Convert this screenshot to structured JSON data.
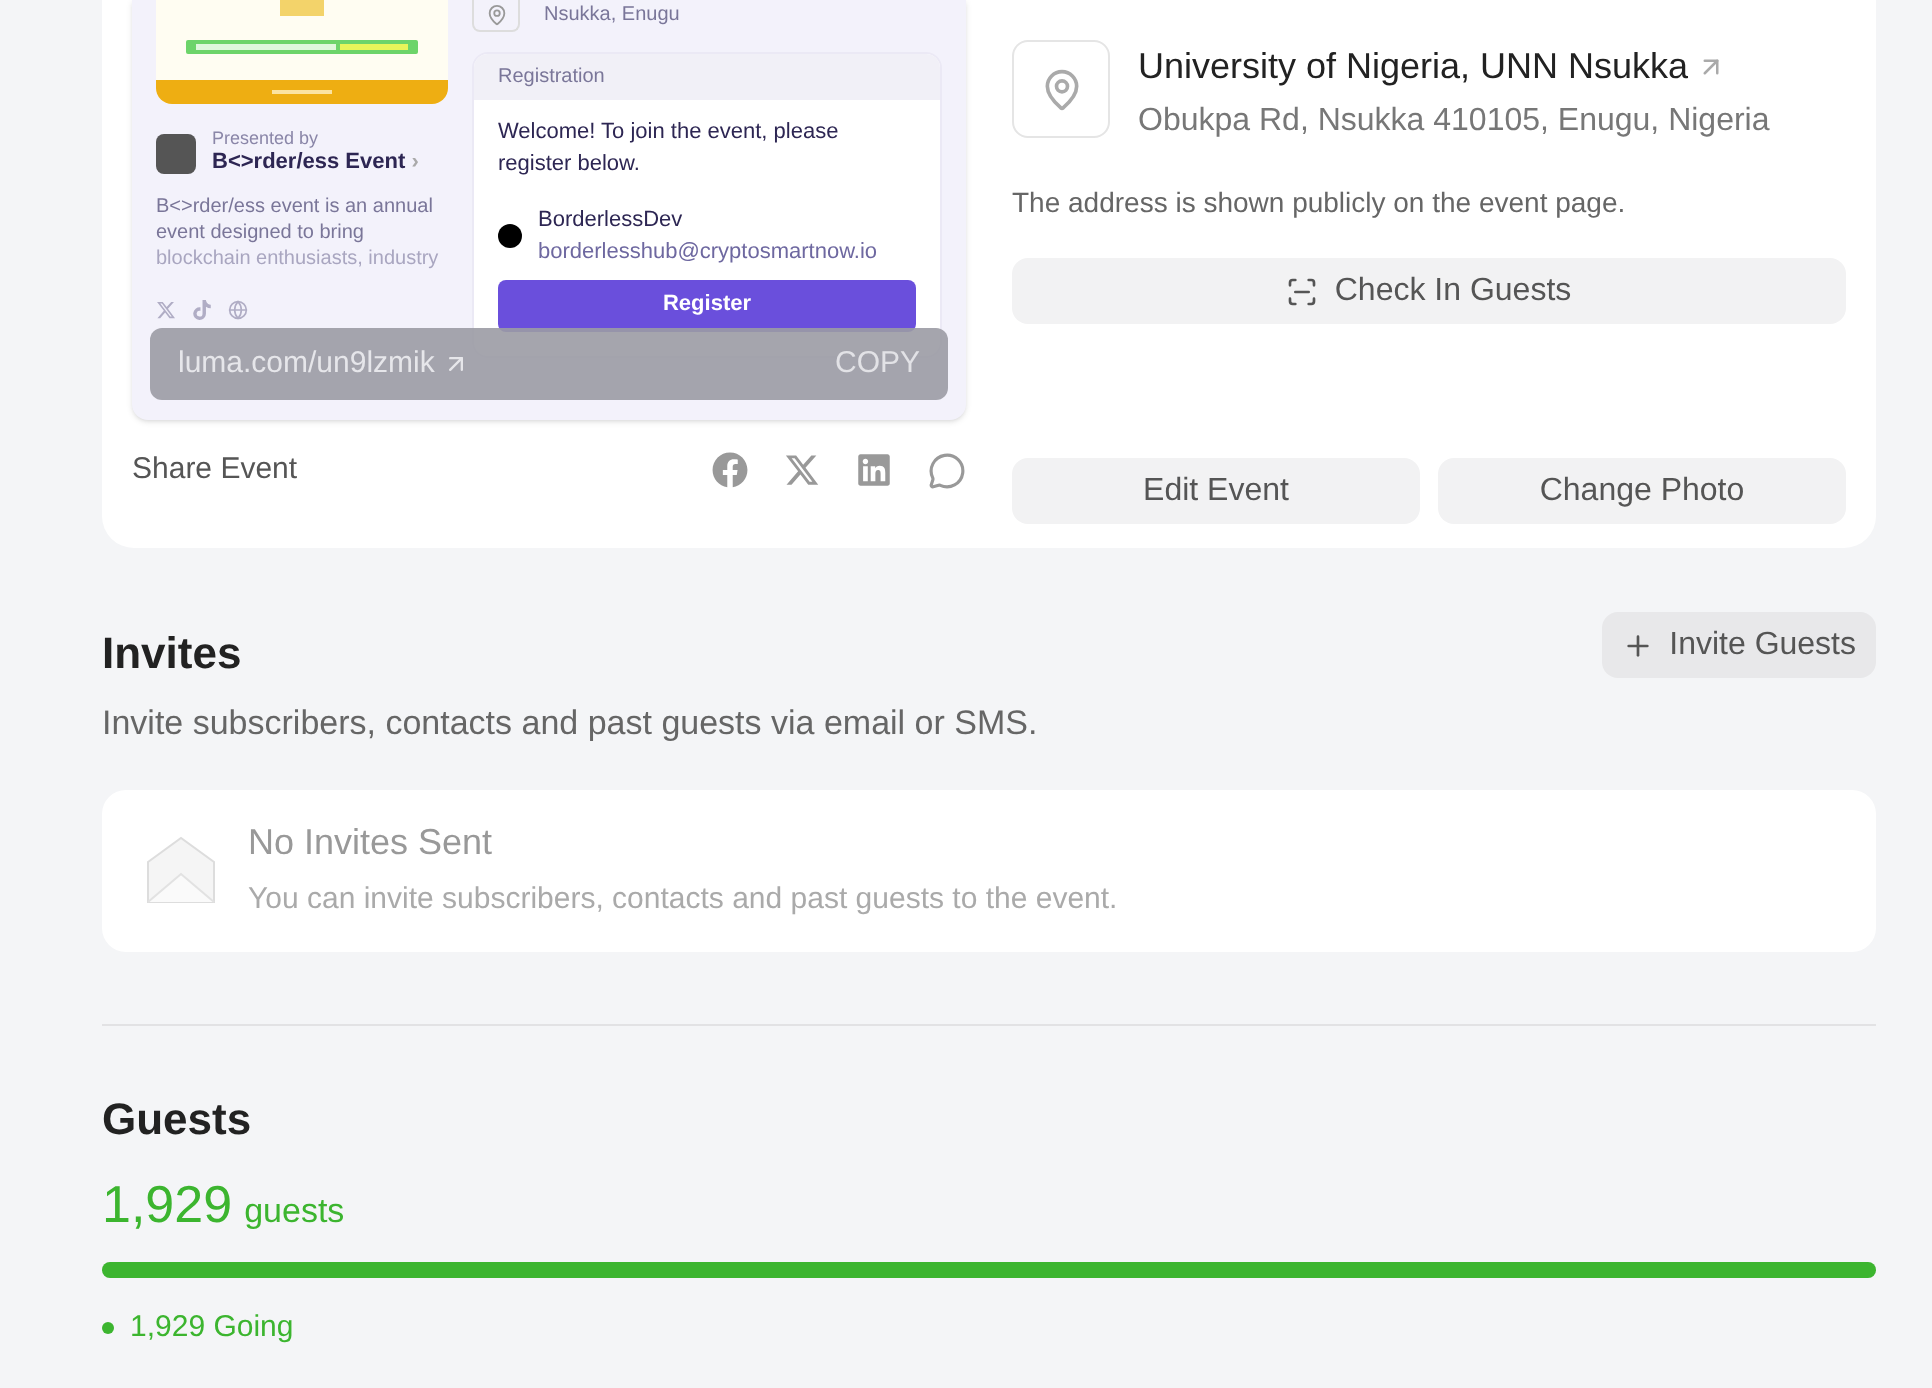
{
  "preview": {
    "presenter": {
      "caption": "Presented by",
      "name": "B<>rder/ess Event",
      "chevron": "›"
    },
    "description": "B<>rder/ess event is an annual event designed to bring",
    "description_faded": "blockchain enthusiasts, industry",
    "location": "Nsukka, Enugu",
    "registration": {
      "title": "Registration",
      "message": "Welcome! To join the event, please register below.",
      "host_name": "BorderlessDev",
      "host_email": "borderlesshub@cryptosmartnow.io",
      "button": "Register"
    },
    "link": {
      "url": "luma.com/un9lzmik",
      "copy": "COPY"
    }
  },
  "share": {
    "label": "Share Event"
  },
  "location": {
    "name": "University of Nigeria, UNN Nsukka",
    "address": "Obukpa Rd, Nsukka 410105, Enugu, Nigeria",
    "note": "The address is shown publicly on the event page."
  },
  "buttons": {
    "check_in": "Check In Guests",
    "edit": "Edit Event",
    "change_photo": "Change Photo"
  },
  "invites": {
    "title": "Invites",
    "subtitle": "Invite subscribers, contacts and past guests via email or SMS.",
    "button": "Invite Guests",
    "empty_title": "No Invites Sent",
    "empty_text": "You can invite subscribers, contacts and past guests to the event."
  },
  "guests": {
    "title": "Guests",
    "count": "1,929",
    "unit": "guests",
    "level": 1,
    "legend": [
      {
        "label": "1,929 Going",
        "color": "#3cb52f"
      }
    ]
  }
}
